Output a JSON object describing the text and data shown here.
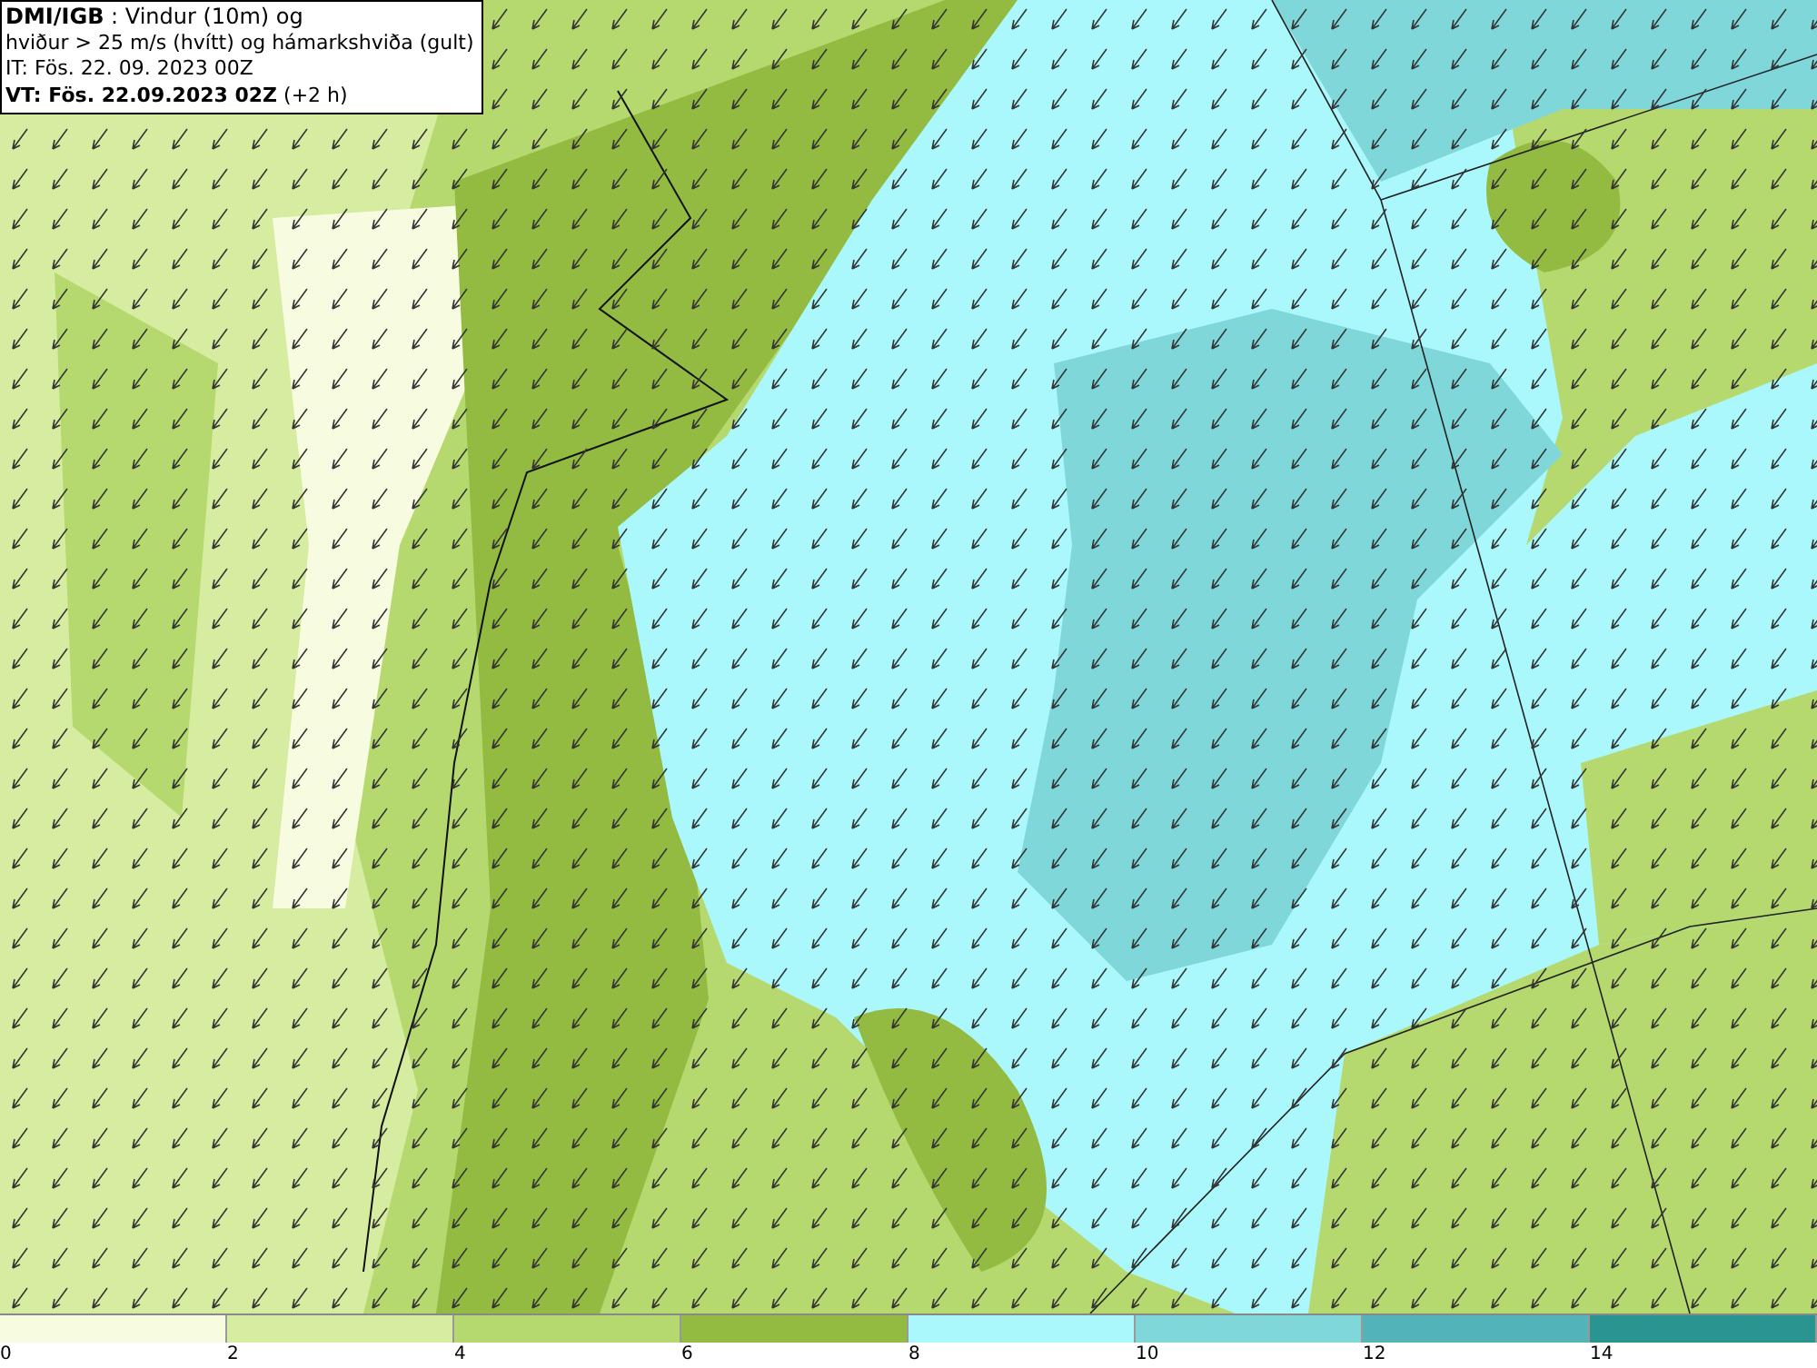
{
  "title_box": {
    "lines": [
      "**DMI/IGB** : Vindur (10m) og",
      "hviður > 25 m/s (hvítt) og hámarkshviða (gult)",
      "IT: Fös. 22. 09. 2023 00Z",
      "**VT: Fös. 22.09.2023 02Z** (+2 h)"
    ]
  },
  "legend": {
    "bins": [
      {
        "color": "#f7fce0"
      },
      {
        "color": "#d6eca0"
      },
      {
        "color": "#b5d96f"
      },
      {
        "color": "#93bb41"
      },
      {
        "color": "#aaf8fb"
      },
      {
        "color": "#7fd7da"
      },
      {
        "color": "#52b4b8"
      },
      {
        "color": "#2a9490"
      }
    ],
    "ticks": [
      "0",
      "2",
      "4",
      "6",
      "8",
      "10",
      "12",
      "14"
    ]
  }
}
